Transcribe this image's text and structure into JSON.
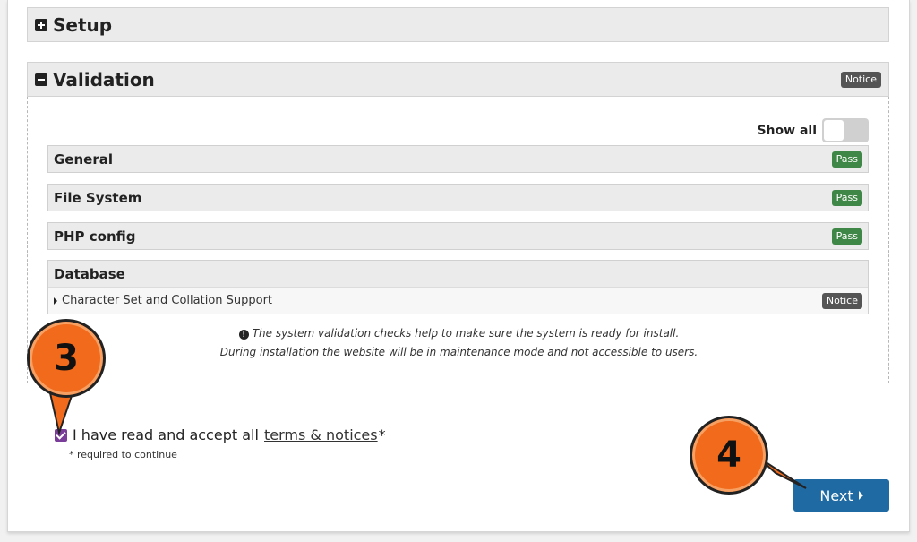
{
  "setup": {
    "title": "Setup"
  },
  "validation": {
    "title": "Validation",
    "status_badge": "Notice",
    "show_all_label": "Show all",
    "show_all_on": false,
    "checks": [
      {
        "name": "General",
        "status": "Pass"
      },
      {
        "name": "File System",
        "status": "Pass"
      },
      {
        "name": "PHP config",
        "status": "Pass"
      }
    ],
    "database": {
      "name": "Database",
      "items": [
        {
          "label": "Character Set and Collation Support",
          "status": "Notice"
        }
      ]
    },
    "info_line1": "The system validation checks help to make sure the system is ready for install.",
    "info_line2": "During installation the website will be in maintenance mode and not accessible to users."
  },
  "accept": {
    "checked": true,
    "text_before": "I have read and accept all",
    "link_text": "terms & notices",
    "asterisk": "*",
    "required_note": "* required to continue"
  },
  "next_button": {
    "label": "Next"
  },
  "callouts": [
    {
      "number": "3"
    },
    {
      "number": "4"
    }
  ],
  "colors": {
    "pass": "#3f8746",
    "notice": "#555555",
    "primary_button": "#1f6aa3",
    "checkbox": "#7a3e9a",
    "callout": "#f26a1b"
  }
}
